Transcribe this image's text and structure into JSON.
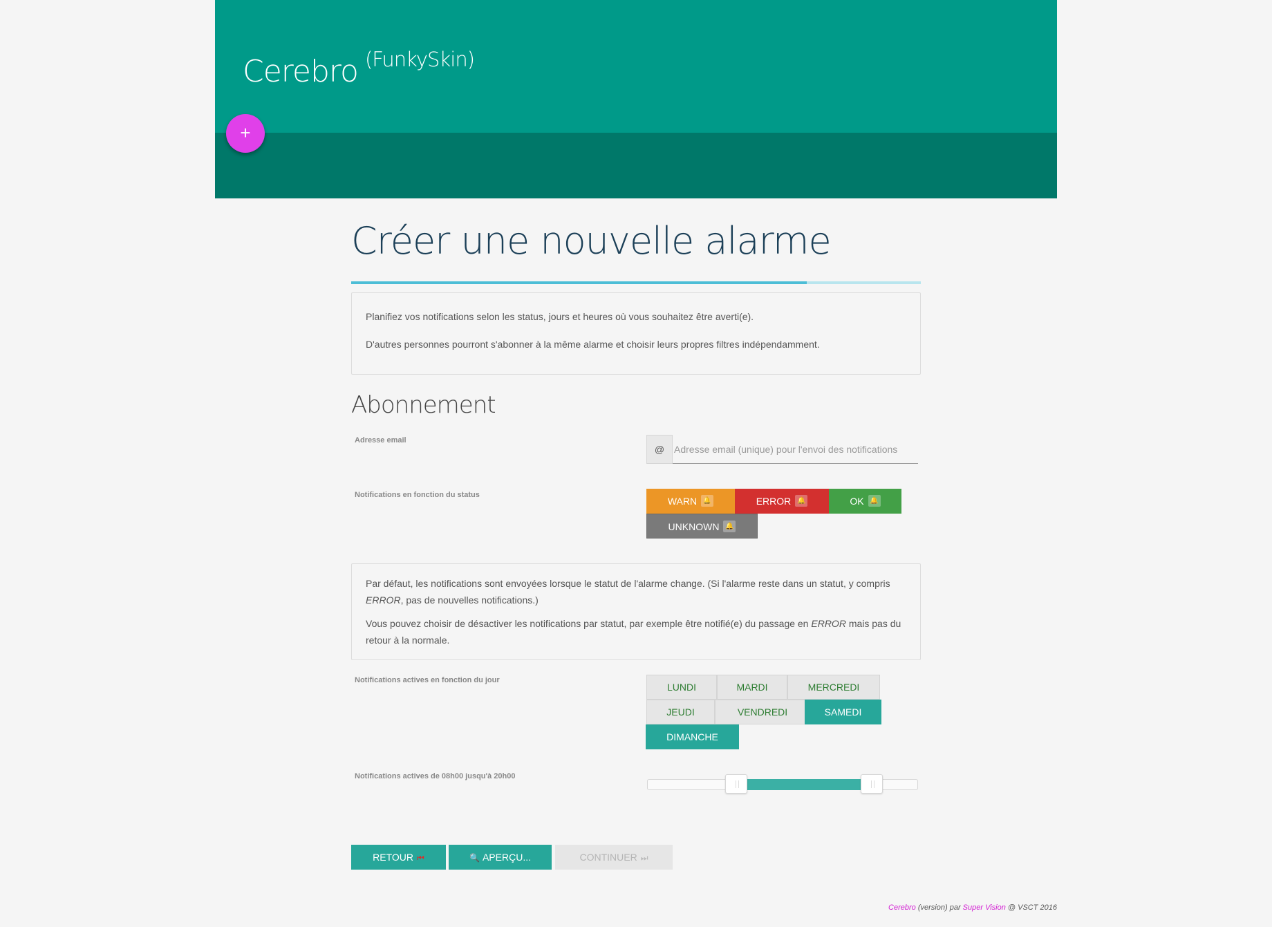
{
  "header": {
    "brand": "Cerebro",
    "skin": "(FunkySkin)",
    "fab_label": "+"
  },
  "page": {
    "title": "Créer une nouvelle alarme",
    "intro": [
      "Planifiez vos notifications selon les status, jours et heures où vous souhaitez être averti(e).",
      "D'autres personnes pourront s'abonner à la même alarme et choisir leurs propres filtres indépendamment."
    ]
  },
  "subscription": {
    "section_title": "Abonnement",
    "email": {
      "label": "Adresse email",
      "prefix": "@",
      "placeholder": "Adresse email (unique) pour l'envoi des notifications",
      "value": ""
    },
    "status": {
      "label": "Notifications en fonction du status",
      "buttons": [
        "WARN",
        "ERROR",
        "OK",
        "UNKNOWN"
      ],
      "colors": {
        "warn": "#ec9626",
        "error": "#d3302f",
        "ok": "#43a047",
        "unknown": "#7a7a7a"
      }
    },
    "info": {
      "p1_before": "Par défaut, les notifications sont envoyées lorsque le statut de l'alarme change. (Si l'alarme reste dans un statut, y compris ",
      "p1_em": "ERROR",
      "p1_after": ", pas de nouvelles notifications.)",
      "p2_before": "Vous pouvez choisir de désactiver les notifications par statut, par exemple être notifié(e) du passage en ",
      "p2_em": "ERROR",
      "p2_after": " mais pas du retour à la normale."
    },
    "days": {
      "label": "Notifications actives en fonction du jour",
      "items": [
        {
          "name": "LUNDI",
          "active": false
        },
        {
          "name": "MARDI",
          "active": false
        },
        {
          "name": "MERCREDI",
          "active": false
        },
        {
          "name": "JEUDI",
          "active": false
        },
        {
          "name": "VENDREDI",
          "active": false
        },
        {
          "name": "SAMEDI",
          "active": true
        },
        {
          "name": "DIMANCHE",
          "active": true
        }
      ]
    },
    "hours": {
      "label": "Notifications actives de 08h00 jusqu'à 20h00",
      "range_start_fraction": 0.33,
      "range_end_fraction": 0.83
    }
  },
  "actions": {
    "back": "RETOUR",
    "preview": "APERÇU...",
    "continue": "CONTINUER"
  },
  "footer": {
    "app": "Cerebro",
    "version": "(version)",
    "par": "par",
    "team": "Super Vision",
    "suffix": "@ VSCT 2016"
  },
  "colors": {
    "header": "#009a89",
    "header_dark": "#007869",
    "fab": "#e040e9",
    "accent": "#27a79a"
  }
}
